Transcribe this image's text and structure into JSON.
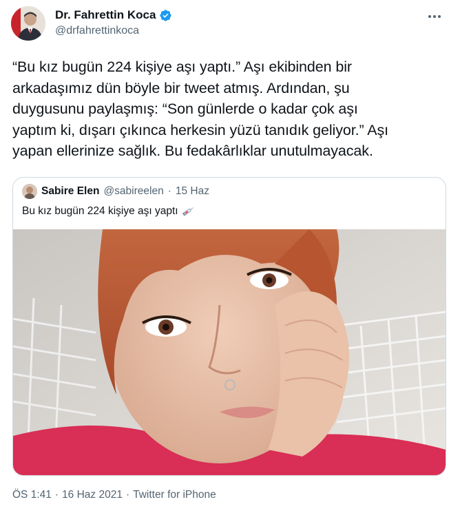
{
  "author": {
    "display_name": "Dr. Fahrettin Koca",
    "handle": "@drfahrettinkoca",
    "verified": true,
    "avatar_icon": "profile-photo"
  },
  "tweet": {
    "lines": [
      "“Bu kız bugün 224 kişiye aşı yaptı.” Aşı ekibinden bir",
      "arkadaşımız dün böyle bir tweet atmış. Ardından, şu",
      "duygusunu paylaşmış: “Son günlerde o kadar çok aşı",
      "yaptım ki, dışarı çıkınca herkesin yüzü tanıdık geliyor.” Aşı",
      "yapan ellerinize sağlık. Bu fedakârlıklar unutulmayacak."
    ]
  },
  "quote": {
    "display_name": "Sabire Elen",
    "handle": "@sabireelen",
    "separator": "·",
    "date": "15 Haz",
    "text": "Bu kız bugün 224 kişiye aşı yaptı",
    "emoji_icon": "syringe-icon"
  },
  "footer": {
    "time": "ÖS 1:41",
    "separator1": "·",
    "date": "16 Haz 2021",
    "separator2": "·",
    "source": "Twitter for iPhone"
  },
  "colors": {
    "verified_blue": "#1d9bf0",
    "text": "#0f1419",
    "secondary": "#536471",
    "border": "#cfd9de"
  }
}
